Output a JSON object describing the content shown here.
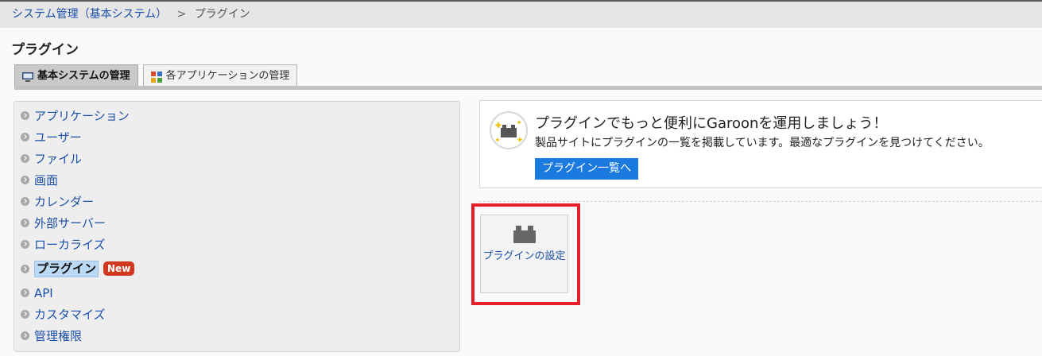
{
  "breadcrumb": {
    "parent": "システム管理（基本システム）",
    "separator": ">",
    "current": "プラグイン"
  },
  "page_title": "プラグイン",
  "tabs": [
    {
      "label": "基本システムの管理",
      "active": true,
      "icon": "computer-icon"
    },
    {
      "label": "各アプリケーションの管理",
      "active": false,
      "icon": "apps-grid-icon"
    }
  ],
  "menu": {
    "items": [
      {
        "label": "アプリケーション"
      },
      {
        "label": "ユーザー"
      },
      {
        "label": "ファイル"
      },
      {
        "label": "画面"
      },
      {
        "label": "カレンダー"
      },
      {
        "label": "外部サーバー"
      },
      {
        "label": "ローカライズ"
      },
      {
        "label": "プラグイン",
        "badge": "New",
        "selected": true
      },
      {
        "label": "API"
      },
      {
        "label": "カスタマイズ"
      },
      {
        "label": "管理権限"
      }
    ]
  },
  "promo": {
    "heading": "プラグインでもっと便利にGaroonを運用しましょう！",
    "description": "製品サイトにプラグインの一覧を掲載しています。最適なプラグインを見つけてください。",
    "button_label": "プラグイン一覧へ"
  },
  "plugin_tile": {
    "label": "プラグインの設定",
    "icon": "plugin-block-icon"
  },
  "colors": {
    "link": "#1c4fa8",
    "button": "#1a7ae0",
    "badge": "#d0391f",
    "highlight": "#e51e2a"
  }
}
